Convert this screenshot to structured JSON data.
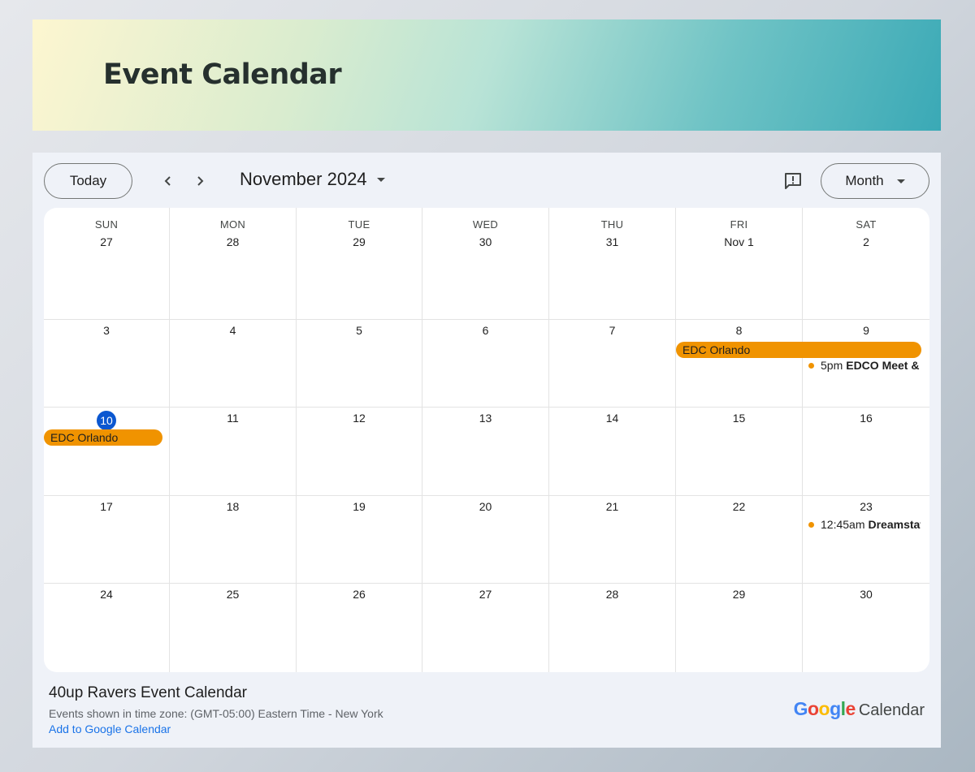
{
  "banner": {
    "title": "Event Calendar"
  },
  "toolbar": {
    "today_label": "Today",
    "prev_icon": "chevron-left-icon",
    "next_icon": "chevron-right-icon",
    "month_label": "November 2024",
    "feedback_icon": "feedback-icon",
    "view_label": "Month"
  },
  "calendar": {
    "weekdays": [
      "SUN",
      "MON",
      "TUE",
      "WED",
      "THU",
      "FRI",
      "SAT"
    ],
    "weeks": [
      [
        "27",
        "28",
        "29",
        "30",
        "31",
        "Nov 1",
        "2"
      ],
      [
        "3",
        "4",
        "5",
        "6",
        "7",
        "8",
        "9"
      ],
      [
        "10",
        "11",
        "12",
        "13",
        "14",
        "15",
        "16"
      ],
      [
        "17",
        "18",
        "19",
        "20",
        "21",
        "22",
        "23"
      ],
      [
        "24",
        "25",
        "26",
        "27",
        "28",
        "29",
        "30"
      ]
    ],
    "today": "10",
    "event_color": "#f09300",
    "today_color": "#0b57d0",
    "events": {
      "edc_week2": {
        "title": "EDC Orlando"
      },
      "edc_week3": {
        "title": "EDC Orlando"
      },
      "edco_meet": {
        "time": "5pm",
        "title": "EDCO Meet &"
      },
      "dreamstate": {
        "time": "12:45am",
        "title": "Dreamstate"
      }
    }
  },
  "footer": {
    "title": "40up Ravers Event Calendar",
    "timezone": "Events shown in time zone: (GMT-05:00) Eastern Time - New York",
    "add_link": "Add to Google Calendar",
    "brand_letters": [
      {
        "ch": "G",
        "color": "#4285f4"
      },
      {
        "ch": "o",
        "color": "#ea4335"
      },
      {
        "ch": "o",
        "color": "#fbbc05"
      },
      {
        "ch": "g",
        "color": "#4285f4"
      },
      {
        "ch": "l",
        "color": "#34a853"
      },
      {
        "ch": "e",
        "color": "#ea4335"
      }
    ],
    "brand_suffix": "Calendar"
  }
}
